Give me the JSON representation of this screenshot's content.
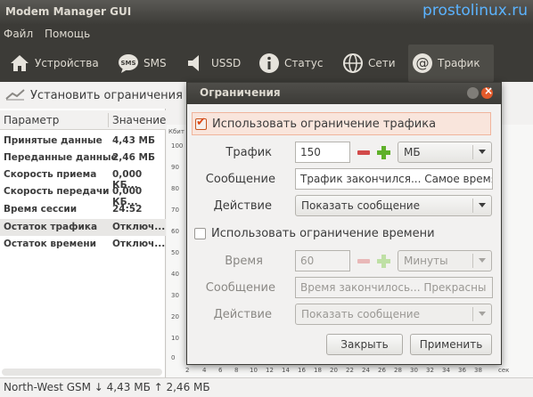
{
  "app": {
    "title": "Modem Manager GUI",
    "watermark": "prostolinux.ru"
  },
  "menu": [
    "Файл",
    "Помощь"
  ],
  "toolbar": [
    {
      "label": "Устройства",
      "icon": "home-icon"
    },
    {
      "label": "SMS",
      "icon": "sms-icon"
    },
    {
      "label": "USSD",
      "icon": "ussd-speaker-icon"
    },
    {
      "label": "Статус",
      "icon": "info-icon"
    },
    {
      "label": "Сети",
      "icon": "globe-icon"
    },
    {
      "label": "Трафик",
      "icon": "at-icon",
      "active": true
    }
  ],
  "left": {
    "action_label": "Установить ограничения",
    "columns": [
      "Параметр",
      "Значение"
    ],
    "rows": [
      {
        "param": "Принятые данные",
        "value": "4,43 МБ"
      },
      {
        "param": "Переданные данные",
        "value": "2,46 МБ"
      },
      {
        "param": "Скорость приема",
        "value": "0,000 КБ..."
      },
      {
        "param": "Скорость передачи",
        "value": "0,000 КБ..."
      },
      {
        "param": "Время сессии",
        "value": "24:52"
      },
      {
        "param": "Остаток трафика",
        "value": "Отключ...",
        "selected": true
      },
      {
        "param": "Остаток времени",
        "value": "Отключ..."
      }
    ]
  },
  "graph": {
    "y_unit": "Кбит",
    "y_ticks": [
      "100",
      "90",
      "80",
      "70",
      "60",
      "50",
      "40",
      "30",
      "20",
      "10",
      "0"
    ],
    "x_ticks": [
      "2",
      "4",
      "6",
      "8",
      "10",
      "12",
      "14",
      "16",
      "18",
      "20",
      "22",
      "24",
      "26",
      "28",
      "30",
      "32",
      "34",
      "36",
      "38"
    ],
    "x_unit": "сек"
  },
  "status": "North-West GSM ↓ 4,43 МБ ↑ 2,46 МБ",
  "dialog": {
    "title": "Ограничения",
    "traffic_section": {
      "checkbox_label": "Использовать ограничение трафика",
      "checked": true,
      "traffic_label": "Трафик",
      "traffic_value": "150",
      "traffic_unit": "МБ",
      "message_label": "Сообщение",
      "message_value": "Трафик закончился... Самое время",
      "action_label": "Действие",
      "action_value": "Показать сообщение"
    },
    "time_section": {
      "checkbox_label": "Использовать ограничение времени",
      "checked": false,
      "time_label": "Время",
      "time_value": "60",
      "time_unit": "Минуты",
      "message_label": "Сообщение",
      "message_value": "Время закончилось... Прекрасны",
      "action_label": "Действие",
      "action_value": "Показать сообщение"
    },
    "buttons": {
      "close": "Закрыть",
      "apply": "Применить"
    }
  },
  "colors": {
    "accent": "#dd4814",
    "toolbar_bg": "#3c3b37",
    "plus": "#5fb02a",
    "minus": "#d24a4a"
  }
}
